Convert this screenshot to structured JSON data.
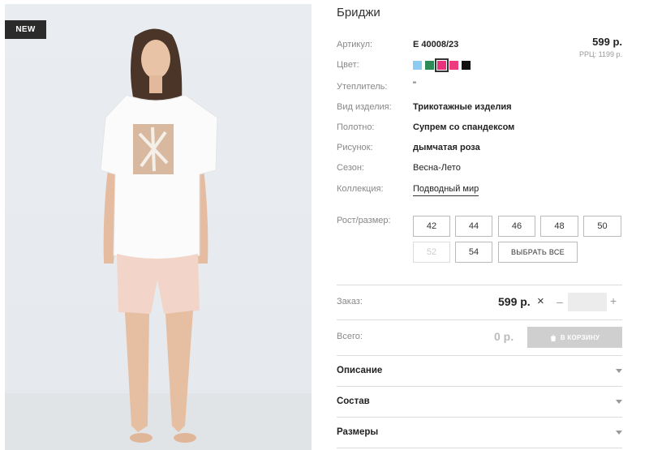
{
  "badge": "NEW",
  "product": {
    "title": "Бриджи",
    "price": "599 р.",
    "rrp": "РРЦ: 1199 р."
  },
  "specs": {
    "article_label": "Артикул:",
    "article_value": "Е 40008/23",
    "color_label": "Цвет:",
    "insulation_label": "Утеплитель:",
    "insulation_value": "\"",
    "type_label": "Вид изделия:",
    "type_value": "Трикотажные изделия",
    "fabric_label": "Полотно:",
    "fabric_value": "Супрем со спандексом",
    "pattern_label": "Рисунок:",
    "pattern_value": "дымчатая роза",
    "season_label": "Сезон:",
    "season_value": "Весна-Лето",
    "collection_label": "Коллекция:",
    "collection_value": "Подводный мир"
  },
  "colors": [
    "#8ecbf3",
    "#2e8b57",
    "#e8327c",
    "#ee3a7e",
    "#111111"
  ],
  "selected_color_index": 2,
  "sizes": {
    "label": "Рост/размер:",
    "items": [
      {
        "label": "42",
        "enabled": true
      },
      {
        "label": "44",
        "enabled": true
      },
      {
        "label": "46",
        "enabled": true
      },
      {
        "label": "48",
        "enabled": true
      },
      {
        "label": "50",
        "enabled": true
      },
      {
        "label": "52",
        "enabled": false
      },
      {
        "label": "54",
        "enabled": true
      }
    ],
    "select_all": "ВЫБРАТЬ ВСЕ"
  },
  "order": {
    "label": "Заказ:",
    "price": "599 р.",
    "times": "×",
    "minus": "–",
    "plus": "+",
    "qty": ""
  },
  "total": {
    "label": "Всего:",
    "value": "0 р.",
    "cart_button": "В КОРЗИНУ"
  },
  "accordion": [
    "Описание",
    "Состав",
    "Размеры"
  ]
}
